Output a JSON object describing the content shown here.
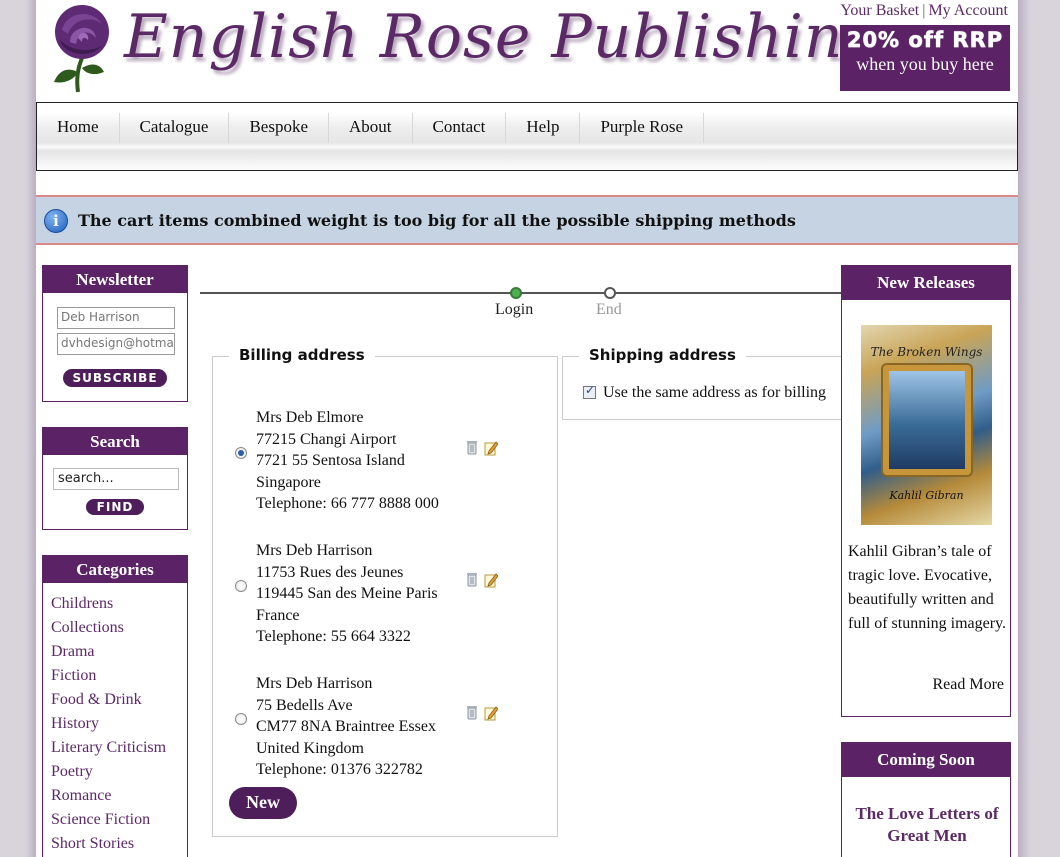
{
  "header": {
    "brand": "English Rose Publishing",
    "basket_link": "Your Basket",
    "separator": "|",
    "account_link": "My Account",
    "promo_big": "20% off RRP",
    "promo_small": "when you buy here"
  },
  "nav": {
    "items": [
      "Home",
      "Catalogue",
      "Bespoke",
      "About",
      "Contact",
      "Help",
      "Purple Rose"
    ]
  },
  "alert": {
    "icon": "info-icon",
    "text": "The cart items combined weight is too big for all the possible shipping methods"
  },
  "newsletter": {
    "title": "Newsletter",
    "name_value": "Deb Harrison",
    "email_value": "dvhdesign@hotma",
    "subscribe_label": "SUBSCRIBE"
  },
  "search": {
    "title": "Search",
    "value": "search...",
    "find_label": "FIND"
  },
  "categories": {
    "title": "Categories",
    "items": [
      "Childrens",
      "Collections",
      "Drama",
      "Fiction",
      "Food & Drink",
      "History",
      "Literary Criticism",
      "Poetry",
      "Romance",
      "Science Fiction",
      "Short Stories"
    ]
  },
  "checkout_steps": {
    "steps": [
      {
        "label": "Login",
        "state": "done"
      },
      {
        "label": "End",
        "state": "pending"
      }
    ]
  },
  "billing": {
    "legend": "Billing address",
    "addresses": [
      {
        "selected": true,
        "lines": [
          "Mrs Deb Elmore",
          "77215 Changi Airport",
          "7721 55 Sentosa Island",
          "Singapore",
          "Telephone: 66 777 8888 000"
        ]
      },
      {
        "selected": false,
        "lines": [
          "Mrs Deb Harrison",
          "11753 Rues des Jeunes",
          "119445 San des Meine Paris",
          "France",
          "Telephone: 55 664 3322"
        ]
      },
      {
        "selected": false,
        "lines": [
          "Mrs Deb Harrison",
          "75 Bedells Ave",
          "CM77 8NA Braintree Essex",
          "United Kingdom",
          "Telephone: 01376 322782"
        ]
      }
    ],
    "new_label": "New"
  },
  "shipping": {
    "legend": "Shipping address",
    "same_as_billing_label": "Use the same address as for billing",
    "same_as_billing_checked": true
  },
  "new_releases": {
    "title": "New Releases",
    "book_title": "The Broken Wings",
    "book_author": "Kahlil Gibran",
    "blurb": "Kahlil Gibran’s tale of tragic love. Evocative, beautifully written and full of stunning imagery.",
    "read_more": "Read More"
  },
  "coming_soon": {
    "title": "Coming Soon",
    "book_title": "The Love Letters of Great Men"
  },
  "colors": {
    "brand_purple": "#5b2366",
    "alert_bg": "#c5d3e3",
    "alert_border": "#d88a8a",
    "step_done": "#4caf50"
  }
}
